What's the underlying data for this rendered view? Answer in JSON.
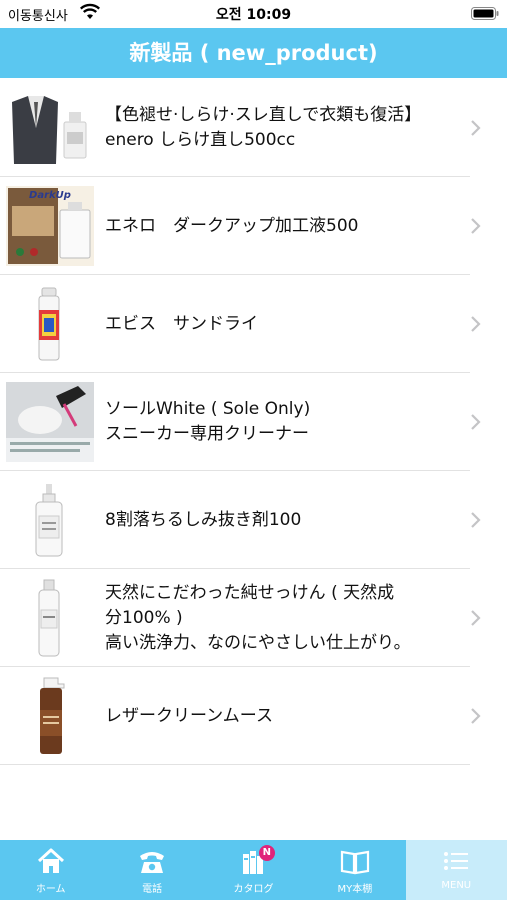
{
  "status_bar": {
    "carrier": "이동통신사",
    "time": "오전 10:09"
  },
  "header": {
    "title": "新製品 ( new_product)"
  },
  "products": [
    {
      "lines": [
        "【色褪せ·しらけ·スレ直しで衣類も復活】",
        "enero しらけ直し500cc"
      ]
    },
    {
      "lines": [
        "エネロ　ダークアップ加工液500"
      ]
    },
    {
      "lines": [
        "エビス　サンドライ"
      ]
    },
    {
      "lines": [
        "ソールWhite ( Sole Only)",
        "スニーカー専用クリーナー"
      ]
    },
    {
      "lines": [
        "8割落ちるしみ抜き剤100"
      ]
    },
    {
      "lines": [
        "天然にこだわった純せっけん ( 天然成",
        "分100% )",
        "高い洗浄力、なのにやさしい仕上がり。"
      ]
    },
    {
      "lines": [
        "レザークリーンムース"
      ]
    }
  ],
  "thumb_texts": {
    "darkup": "DarkUp"
  },
  "tabbar": {
    "tabs": [
      {
        "label": "ホーム",
        "icon": "home-icon"
      },
      {
        "label": "電話",
        "icon": "phone-icon"
      },
      {
        "label": "カタログ",
        "icon": "catalog-icon",
        "badge": "N"
      },
      {
        "label": "MY本棚",
        "icon": "book-icon"
      },
      {
        "label": "MENU",
        "icon": "menu-icon",
        "active": true
      }
    ]
  },
  "colors": {
    "accent": "#5bc7f0",
    "active_tab": "#c8ecfa",
    "badge": "#e0247a"
  }
}
